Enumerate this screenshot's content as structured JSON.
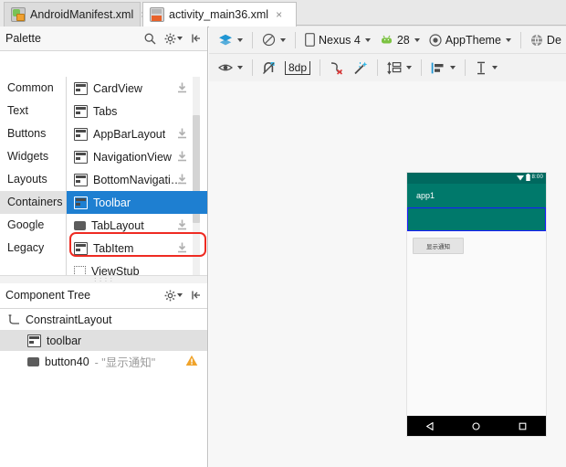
{
  "tabs": [
    {
      "label": "AndroidManifest.xml",
      "icon": "android-manifest-icon",
      "close": "×",
      "active": false
    },
    {
      "label": "activity_main36.xml",
      "icon": "layout-xml-icon",
      "close": "×",
      "active": true
    }
  ],
  "palette": {
    "title": "Palette",
    "categories": [
      {
        "label": "Common",
        "selected": false
      },
      {
        "label": "Text",
        "selected": false
      },
      {
        "label": "Buttons",
        "selected": false
      },
      {
        "label": "Widgets",
        "selected": false
      },
      {
        "label": "Layouts",
        "selected": false
      },
      {
        "label": "Containers",
        "selected": true
      },
      {
        "label": "Google",
        "selected": false
      },
      {
        "label": "Legacy",
        "selected": false
      }
    ],
    "items": [
      {
        "label": "CardView",
        "download": true,
        "selected": false
      },
      {
        "label": "Tabs",
        "download": false,
        "selected": false
      },
      {
        "label": "AppBarLayout",
        "download": true,
        "selected": false
      },
      {
        "label": "NavigationView",
        "download": true,
        "selected": false
      },
      {
        "label": "BottomNavigati…",
        "download": true,
        "selected": false
      },
      {
        "label": "Toolbar",
        "download": false,
        "selected": true
      },
      {
        "label": "TabLayout",
        "download": true,
        "selected": false
      },
      {
        "label": "TabItem",
        "download": true,
        "selected": false
      },
      {
        "label": "ViewStub",
        "download": false,
        "selected": false
      }
    ]
  },
  "component_tree": {
    "title": "Component Tree",
    "rows": [
      {
        "label": "ConstraintLayout",
        "suffix": "",
        "level": 0,
        "selected": false,
        "warning": false,
        "icon": "constraint-layout-icon"
      },
      {
        "label": "toolbar",
        "suffix": "",
        "level": 1,
        "selected": true,
        "warning": false,
        "icon": "toolbar-icon"
      },
      {
        "label": "button40",
        "suffix": "- \"显示通知\"",
        "level": 1,
        "selected": false,
        "warning": true,
        "icon": "button-icon"
      }
    ]
  },
  "design_toolbar": {
    "design_mode": "",
    "orientation": "",
    "device": "Nexus 4",
    "api_level": "28",
    "theme": "AppTheme",
    "locale": "De"
  },
  "constraint_toolbar": {
    "visibility": "",
    "autoconnect": "",
    "default_margin": "8dp",
    "clear_constraints": "",
    "infer_constraints": "",
    "pack": "",
    "align": "",
    "guidelines": ""
  },
  "preview": {
    "status_time": "8:00",
    "app_title": "app1",
    "button_text": "显示通知",
    "nav_back": "◁",
    "nav_home": "○",
    "nav_recents": "□",
    "appbar_color": "#00796b",
    "statusbar_color": "#00695f",
    "selection_color": "#1a1aff"
  },
  "annotation": {
    "highlight_color": "#ee2b22"
  }
}
